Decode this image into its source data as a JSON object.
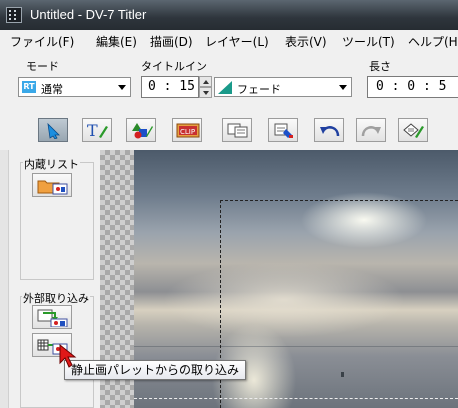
{
  "window": {
    "title": "Untitled - DV-7 Titler",
    "app_icon": "film-strip-icon"
  },
  "menu": [
    "ファイル(F)",
    "編集(E)",
    "描画(D)",
    "レイヤー(L)",
    "表示(V)",
    "ツール(T)",
    "ヘルプ(H)"
  ],
  "controls": {
    "mode_label": "モード",
    "mode_icon_text": "RT",
    "mode_value": "通常",
    "title_in_label": "タイトルイン",
    "title_in_time": "0 : 15",
    "transition_value": "フェード",
    "length_label": "長さ",
    "length_time": "0 : 0 : 5"
  },
  "toolbar": [
    "select-arrow-icon",
    "text-tool-icon",
    "shape-tool-icon",
    "clip-tool-icon",
    "copy-icon",
    "paste-icon",
    "undo-icon",
    "redo-icon",
    "edit-property-icon"
  ],
  "toolbar_clip_text": "CLIP",
  "sidebar": {
    "builtin_list_label": "内蔵リスト",
    "external_import_label": "外部取り込み"
  },
  "tooltip": "静止画パレットからの取り込み",
  "colors": {
    "titlebar": "#2e353c",
    "accent_blue": "#1c5fd0",
    "fade_teal": "#1a9a8a"
  }
}
